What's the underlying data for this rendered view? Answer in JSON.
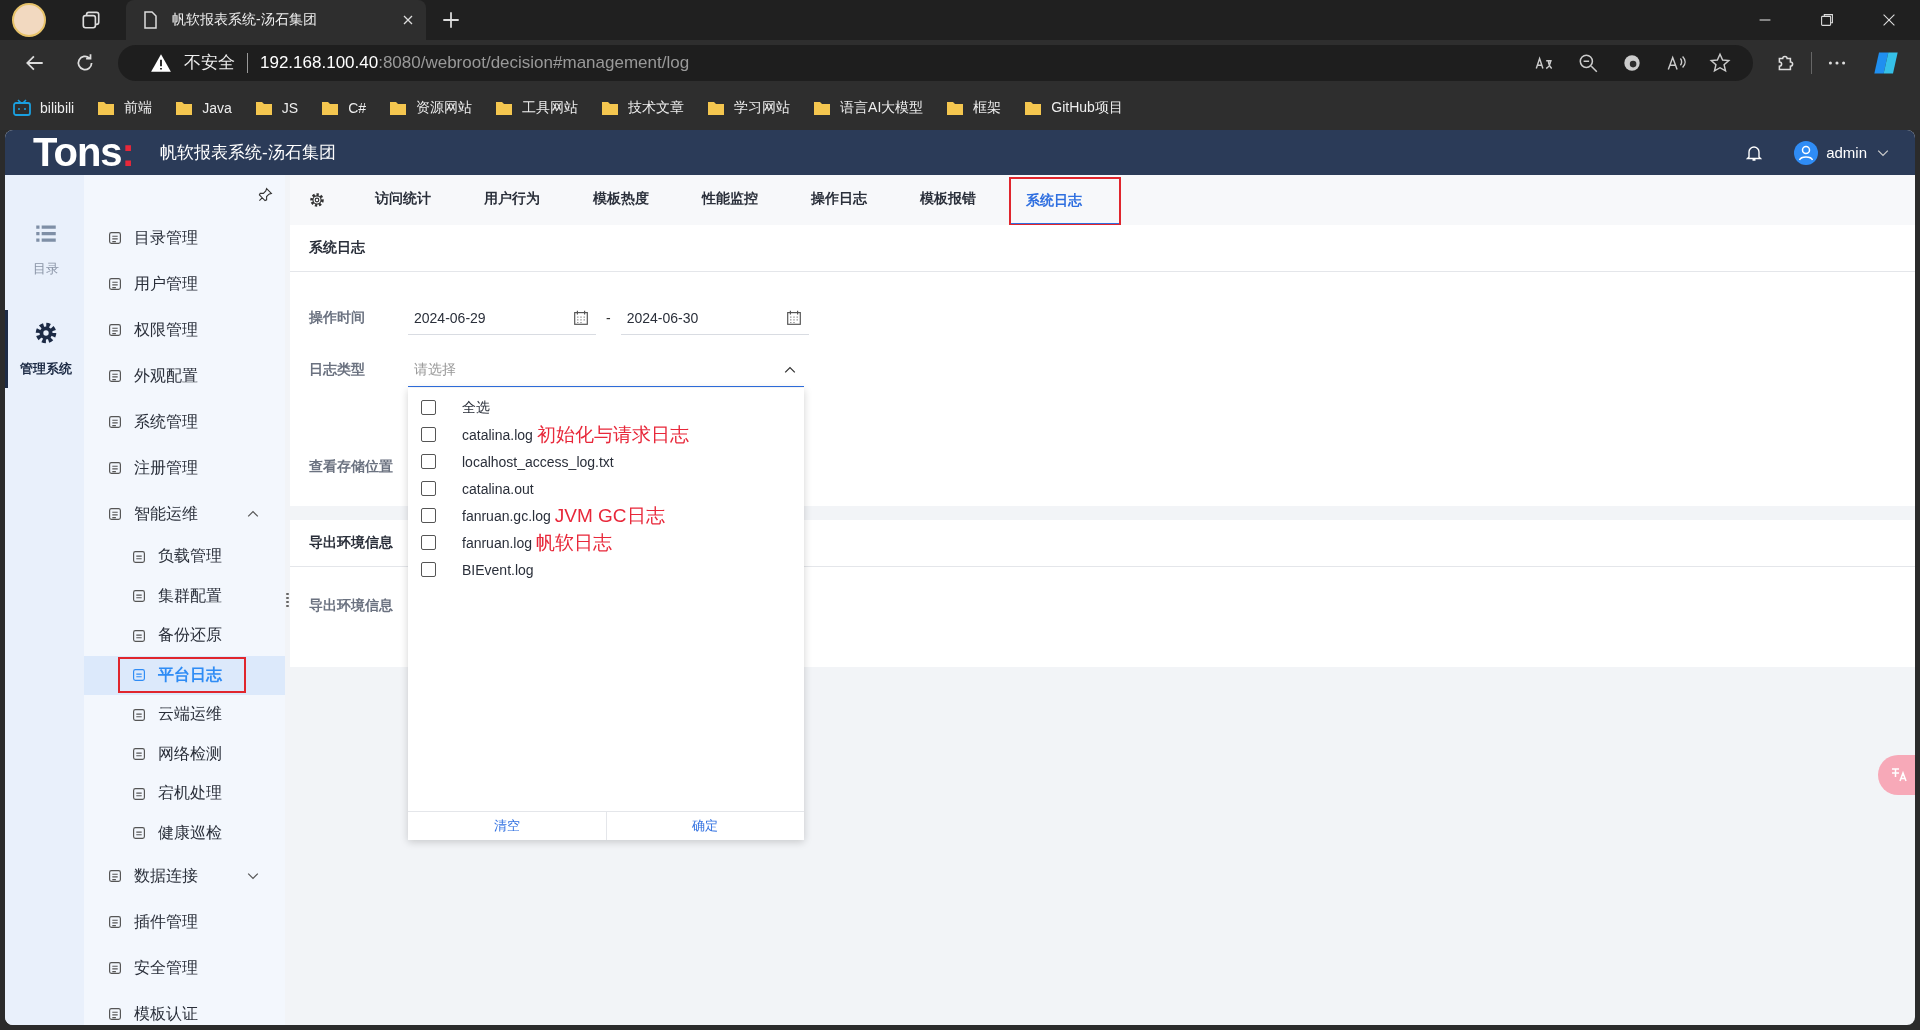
{
  "browser": {
    "tab_title": "帆软报表系统-汤石集团",
    "security": "不安全",
    "url_host": "192.168.100.40",
    "url_path": ":8080/webroot/decision#management/log",
    "bookmarks": [
      {
        "label": "bilibili",
        "kind": "site"
      },
      {
        "label": "前端",
        "kind": "folder"
      },
      {
        "label": "Java",
        "kind": "folder"
      },
      {
        "label": "JS",
        "kind": "folder"
      },
      {
        "label": "C#",
        "kind": "folder"
      },
      {
        "label": "资源网站",
        "kind": "folder"
      },
      {
        "label": "工具网站",
        "kind": "folder"
      },
      {
        "label": "技术文章",
        "kind": "folder"
      },
      {
        "label": "学习网站",
        "kind": "folder"
      },
      {
        "label": "语言AI大模型",
        "kind": "folder"
      },
      {
        "label": "框架",
        "kind": "folder"
      },
      {
        "label": "GitHub项目",
        "kind": "folder"
      }
    ]
  },
  "app": {
    "logo": "Tons",
    "logo_accent": ":",
    "title": "帆软报表系统-汤石集团",
    "user": "admin"
  },
  "rail": [
    {
      "label": "目录",
      "selected": false
    },
    {
      "label": "管理系统",
      "selected": true
    }
  ],
  "menu": [
    {
      "label": "目录管理",
      "selected": false
    },
    {
      "label": "用户管理",
      "selected": false
    },
    {
      "label": "权限管理",
      "selected": false
    },
    {
      "label": "外观配置",
      "selected": false
    },
    {
      "label": "系统管理",
      "selected": false
    },
    {
      "label": "注册管理",
      "selected": false
    },
    {
      "label": "智能运维",
      "selected": false,
      "expanded": true,
      "children": [
        {
          "label": "负载管理",
          "selected": false,
          "highlighted": false
        },
        {
          "label": "集群配置",
          "selected": false,
          "highlighted": false
        },
        {
          "label": "备份还原",
          "selected": false,
          "highlighted": false
        },
        {
          "label": "平台日志",
          "selected": true,
          "highlighted": true
        },
        {
          "label": "云端运维",
          "selected": false,
          "highlighted": false
        },
        {
          "label": "网络检测",
          "selected": false,
          "highlighted": false
        },
        {
          "label": "宕机处理",
          "selected": false,
          "highlighted": false
        },
        {
          "label": "健康巡检",
          "selected": false,
          "highlighted": false
        }
      ]
    },
    {
      "label": "数据连接",
      "selected": false,
      "expanded": false
    },
    {
      "label": "插件管理",
      "selected": false
    },
    {
      "label": "安全管理",
      "selected": false
    },
    {
      "label": "模板认证",
      "selected": false
    }
  ],
  "tabs": [
    {
      "label": "访问统计",
      "selected": false,
      "highlighted": false
    },
    {
      "label": "用户行为",
      "selected": false,
      "highlighted": false
    },
    {
      "label": "模板热度",
      "selected": false,
      "highlighted": false
    },
    {
      "label": "性能监控",
      "selected": false,
      "highlighted": false
    },
    {
      "label": "操作日志",
      "selected": false,
      "highlighted": false
    },
    {
      "label": "模板报错",
      "selected": false,
      "highlighted": false
    },
    {
      "label": "系统日志",
      "selected": true,
      "highlighted": true
    }
  ],
  "section_title": "系统日志",
  "form": {
    "time_label": "操作时间",
    "date_from": "2024-06-29",
    "date_to": "2024-06-30",
    "separator": "-",
    "type_label": "日志类型",
    "type_placeholder": "请选择",
    "storage_label": "查看存储位置"
  },
  "export": {
    "title": "导出环境信息",
    "label": "导出环境信息"
  },
  "dropdown": {
    "options": [
      {
        "label": "全选",
        "checked": false
      },
      {
        "label": "catalina.log",
        "checked": false,
        "note": "初始化与请求日志"
      },
      {
        "label": "localhost_access_log.txt",
        "checked": false
      },
      {
        "label": "catalina.out",
        "checked": false
      },
      {
        "label": "fanruan.gc.log",
        "checked": false,
        "note": "JVM GC日志"
      },
      {
        "label": "fanruan.log",
        "checked": false,
        "note": "帆软日志"
      },
      {
        "label": "BIEvent.log",
        "checked": false
      }
    ],
    "buttons": [
      "清空",
      "确定"
    ]
  }
}
